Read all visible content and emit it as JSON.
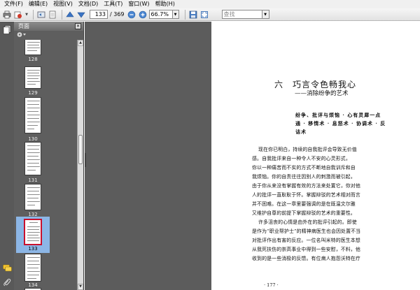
{
  "menu": [
    "文件(F)",
    "编辑(E)",
    "视图(V)",
    "文档(D)",
    "工具(T)",
    "窗口(W)",
    "帮助(H)"
  ],
  "toolbar": {
    "current_page": "133",
    "page_total": "/ 369",
    "zoom": "66.7%",
    "search_placeholder": "查找"
  },
  "panel": {
    "title": "页面"
  },
  "thumbnails": [
    {
      "label": "128",
      "selected": false
    },
    {
      "label": "129",
      "selected": false
    },
    {
      "label": "130",
      "selected": false
    },
    {
      "label": "131",
      "selected": false
    },
    {
      "label": "132",
      "selected": false
    },
    {
      "label": "133",
      "selected": true
    },
    {
      "label": "134",
      "selected": false
    }
  ],
  "document": {
    "title": "六　巧言令色畅我心",
    "subtitle": "——消除纷争的艺术",
    "summary_lines": [
      "纷争、批评与烦恼 · 心有灵犀一点",
      "通 · 移情术 · 息怒术 · 协调术 · 反",
      "诘术"
    ],
    "paragraphs_lines": [
      "现在你已明白，持续的自我批评会导致无价值",
      "感。自我批评来自一种令人不安的心灵形式，",
      "你以一种痛苦而不实的方式不断地自我训斥和自",
      "我烦恼。你的自责往往因别人的刺激而被引起，",
      "由于你从来没有掌握有效的方法来处置它，你对他",
      "人的批评一直耿耿于怀。掌握辩驳的艺术相对而言",
      "并不困难。在这一章里要强调的是在既温文尔雅",
      "又维护自尊的前提下掌握辩驳的艺术的重要性。",
      "许多沮丧的心情是由外在的批评引起的。即使",
      "是作为“职业帮护士”的精神病医生也会因处置不当",
      "对批评作出有害的反应。一位名叫米特的医生本想",
      "从我死扶伤的崇高事业中得到一些安慰，不料，他",
      "收到的是一些消极的反馈。有位病人抱怨沃特在疗"
    ],
    "page_number": "· 177 ·"
  }
}
